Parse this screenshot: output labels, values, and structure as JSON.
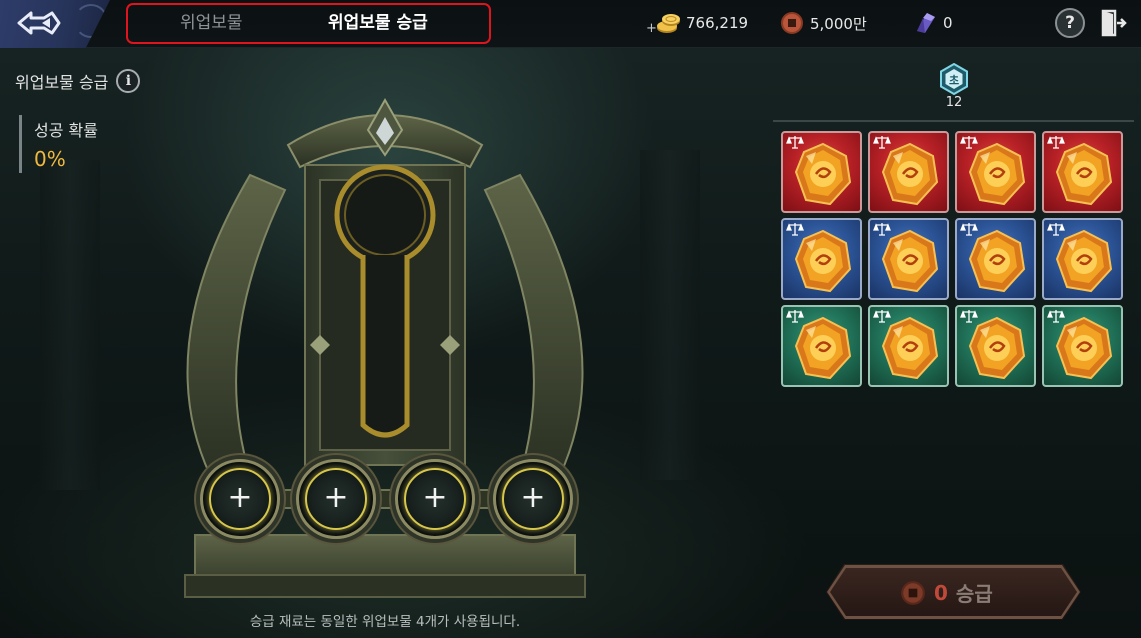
{
  "header": {
    "tabs": [
      {
        "label": "위업보물",
        "active": false
      },
      {
        "label": "위업보물 승급",
        "active": true
      }
    ]
  },
  "currency": {
    "gold": "766,219",
    "coin": "5,000만",
    "gem": "0"
  },
  "help_label": "?",
  "left_panel": {
    "title": "위업보물 승급",
    "success_rate_label": "성공 확률",
    "success_rate_value": "0%"
  },
  "slots": [
    "+",
    "+",
    "+",
    "+"
  ],
  "bottom_note": "승급 재료는 동일한 위업보물 4개가 사용됩니다.",
  "right_panel": {
    "rank_badge": "초",
    "rank_count": "12",
    "items": [
      {
        "grade": "red",
        "icon": "amber-gem-icon"
      },
      {
        "grade": "red",
        "icon": "amber-gem-icon"
      },
      {
        "grade": "red",
        "icon": "amber-gem-icon"
      },
      {
        "grade": "red",
        "icon": "amber-gem-icon"
      },
      {
        "grade": "blue",
        "icon": "amber-gem-icon"
      },
      {
        "grade": "blue",
        "icon": "amber-gem-icon"
      },
      {
        "grade": "blue",
        "icon": "amber-gem-icon"
      },
      {
        "grade": "blue",
        "icon": "amber-gem-icon"
      },
      {
        "grade": "green",
        "icon": "amber-gem-icon"
      },
      {
        "grade": "green",
        "icon": "amber-gem-icon"
      },
      {
        "grade": "green",
        "icon": "amber-gem-icon"
      },
      {
        "grade": "green",
        "icon": "amber-gem-icon"
      }
    ]
  },
  "upgrade_button": {
    "cost": "0",
    "label": "승급"
  },
  "colors": {
    "tab_highlight": "#e0141e",
    "rate_value": "#f0b93e",
    "slot_ring": "#d7c64a"
  }
}
